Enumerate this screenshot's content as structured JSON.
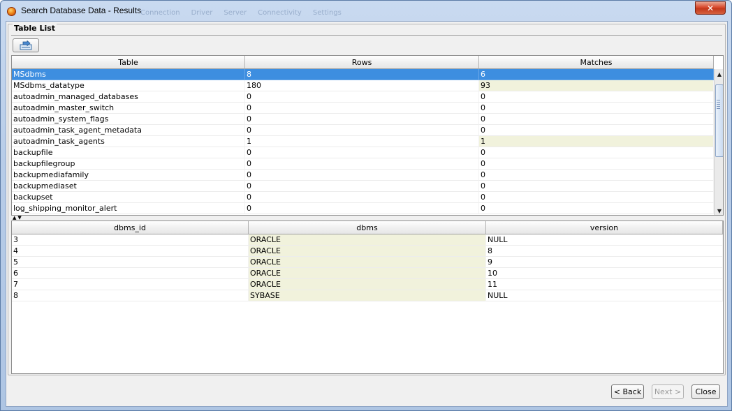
{
  "window": {
    "title": "Search Database Data - Results",
    "background_menu": [
      "Connection",
      "Driver",
      "Server",
      "Connectivity",
      "Settings"
    ],
    "close_glyph": "✕"
  },
  "group": {
    "title": "Table List"
  },
  "top_table": {
    "columns": [
      "Table",
      "Rows",
      "Matches"
    ],
    "rows": [
      [
        "MSdbms",
        "8",
        "6"
      ],
      [
        "MSdbms_datatype",
        "180",
        "93"
      ],
      [
        "autoadmin_managed_databases",
        "0",
        "0"
      ],
      [
        "autoadmin_master_switch",
        "0",
        "0"
      ],
      [
        "autoadmin_system_flags",
        "0",
        "0"
      ],
      [
        "autoadmin_task_agent_metadata",
        "0",
        "0"
      ],
      [
        "autoadmin_task_agents",
        "1",
        "1"
      ],
      [
        "backupfile",
        "0",
        "0"
      ],
      [
        "backupfilegroup",
        "0",
        "0"
      ],
      [
        "backupmediafamily",
        "0",
        "0"
      ],
      [
        "backupmediaset",
        "0",
        "0"
      ],
      [
        "backupset",
        "0",
        "0"
      ],
      [
        "log_shipping_monitor_alert",
        "0",
        "0"
      ]
    ],
    "selected_row": 0
  },
  "bottom_table": {
    "columns": [
      "dbms_id",
      "dbms",
      "version"
    ],
    "rows": [
      [
        "3",
        "ORACLE",
        "NULL"
      ],
      [
        "4",
        "ORACLE",
        "8"
      ],
      [
        "5",
        "ORACLE",
        "9"
      ],
      [
        "6",
        "ORACLE",
        "10"
      ],
      [
        "7",
        "ORACLE",
        "11"
      ],
      [
        "8",
        "SYBASE",
        "NULL"
      ]
    ]
  },
  "buttons": {
    "back": "< Back",
    "next": "Next >",
    "close": "Close"
  },
  "icons": {
    "app": "app-logo-icon",
    "export": "export-icon",
    "scroll_up": "▲",
    "scroll_down": "▼",
    "splitter": "▲▼"
  },
  "colors": {
    "selection": "#3d8ee0",
    "match_highlight": "#f1f2dc"
  }
}
